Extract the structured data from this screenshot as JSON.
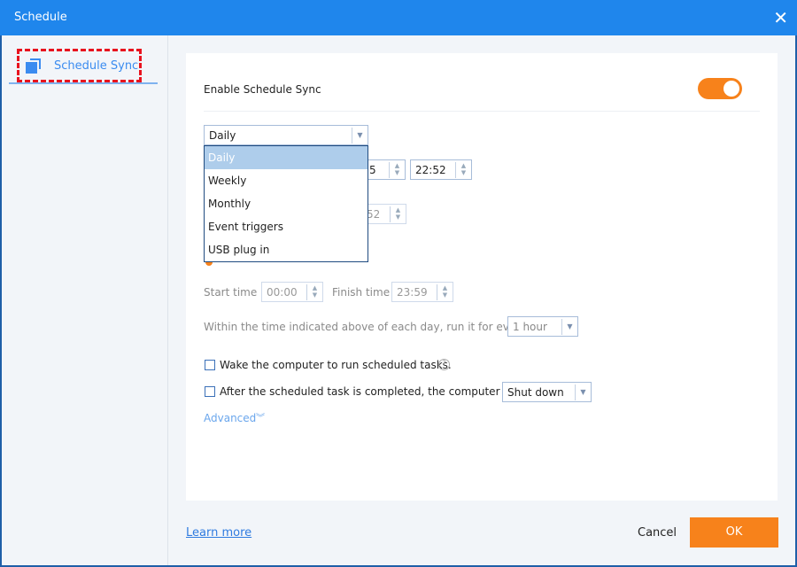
{
  "window": {
    "title": "Schedule"
  },
  "sidebar": {
    "items": [
      {
        "label": "Schedule Sync"
      }
    ]
  },
  "main": {
    "enable_label": "Enable Schedule Sync",
    "enable_on": true,
    "frequency": {
      "selected": "Daily",
      "options": [
        "Daily",
        "Weekly",
        "Monthly",
        "Event triggers",
        "USB plug in"
      ]
    },
    "hidden_field_1": "5",
    "time": "22:52",
    "hidden_field_2": "52",
    "start_label": "Start time",
    "start_value": "00:00",
    "finish_label": "Finish time",
    "finish_value": "23:59",
    "interval_label": "Within the time indicated above of each day, run it for every",
    "interval_value": "1 hour",
    "wake_label": "Wake the computer to run scheduled tasks.",
    "after_label": "After the scheduled task is completed, the computer will",
    "after_value": "Shut down",
    "advanced": "Advanced"
  },
  "footer": {
    "learn_more": "Learn more",
    "cancel": "Cancel",
    "ok": "OK"
  },
  "colors": {
    "accent": "#1f86ec",
    "orange": "#f7821b"
  }
}
